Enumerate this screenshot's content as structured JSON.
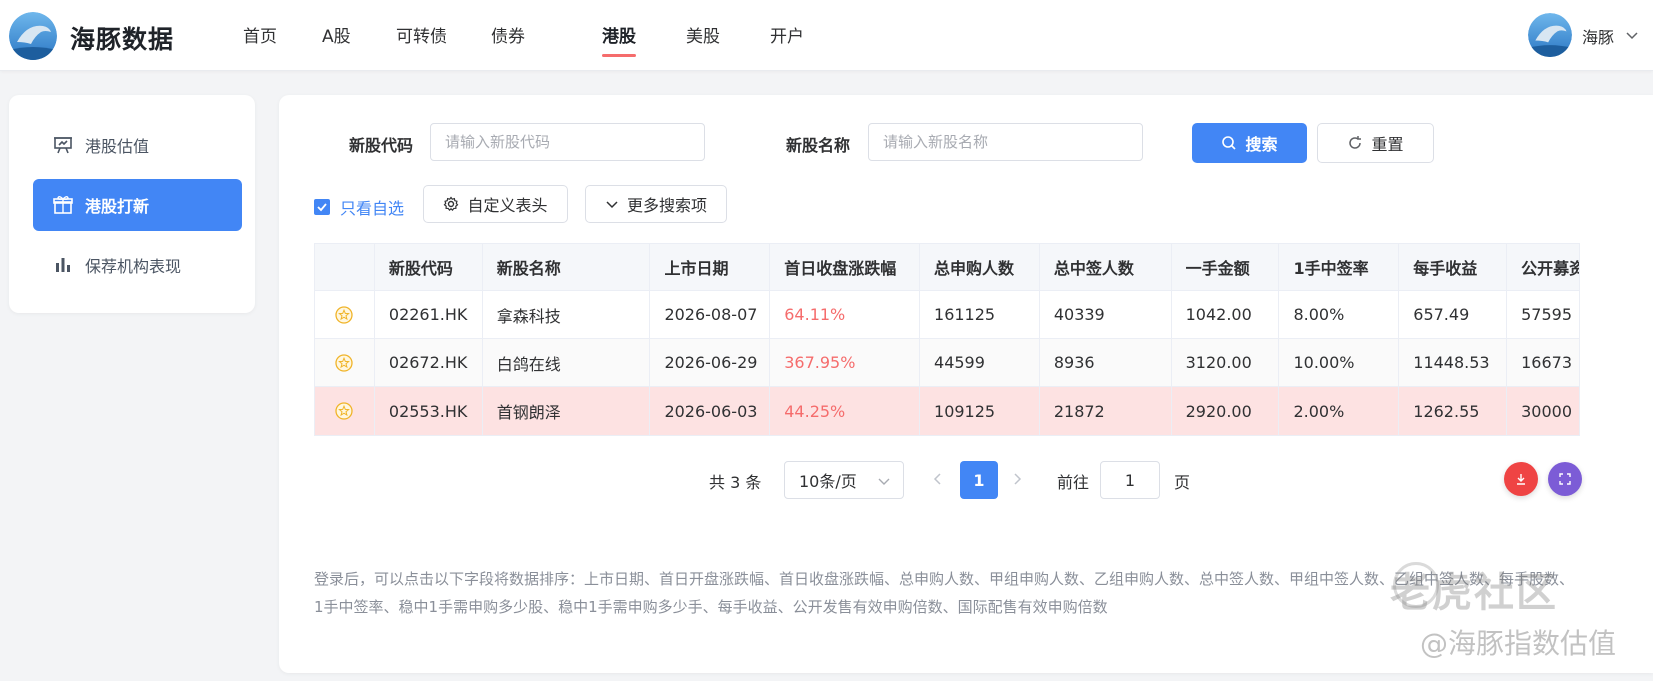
{
  "app": {
    "title": "海豚数据",
    "user_name": "海豚"
  },
  "nav": {
    "items": [
      "首页",
      "A股",
      "可转债",
      "债券",
      "港股",
      "美股",
      "开户"
    ],
    "active": "港股"
  },
  "sidebar": {
    "items": [
      {
        "label": "港股估值",
        "icon": "presentation-icon"
      },
      {
        "label": "港股打新",
        "icon": "gift-icon",
        "active": true
      },
      {
        "label": "保荐机构表现",
        "icon": "bar-chart-icon"
      }
    ]
  },
  "search": {
    "code_label": "新股代码",
    "code_placeholder": "请输入新股代码",
    "name_label": "新股名称",
    "name_placeholder": "请输入新股名称",
    "search_button": "搜索",
    "reset_button": "重置",
    "watchlist_only": "只看自选",
    "custom_header_button": "自定义表头",
    "more_filters_button": "更多搜索项"
  },
  "table": {
    "columns": [
      "",
      "新股代码",
      "新股名称",
      "上市日期",
      "首日收盘涨跌幅",
      "总申购人数",
      "总中签人数",
      "一手金额",
      "1手中签率",
      "每手收益",
      "公开募资"
    ],
    "rows": [
      [
        "",
        "02261.HK",
        "拿森科技",
        "2026-08-07",
        "64.11%",
        "161125",
        "40339",
        "1042.00",
        "8.00%",
        "657.49",
        "57595"
      ],
      [
        "",
        "02672.HK",
        "白鸽在线",
        "2026-06-29",
        "367.95%",
        "44599",
        "8936",
        "3120.00",
        "10.00%",
        "11448.53",
        "16673"
      ],
      [
        "",
        "02553.HK",
        "首钢朗泽",
        "2026-06-03",
        "44.25%",
        "109125",
        "21872",
        "2920.00",
        "2.00%",
        "1262.55",
        "30000"
      ]
    ]
  },
  "pagination": {
    "total": "共 3 条",
    "page_size": "10条/页",
    "current_page": "1",
    "goto_label": "前往",
    "goto_value": "1",
    "page_suffix": "页"
  },
  "note": "登录后，可以点击以下字段将数据排序：上市日期、首日开盘涨跌幅、首日收盘涨跌幅、总申购人数、甲组申购人数、乙组申购人数、总中签人数、甲组中签人数、乙组中签人数、每手股数、1手中签率、稳中1手需申购多少股、稳中1手需申购多少手、每手收益、公开发售有效申购倍数、国际配售有效申购倍数",
  "watermark": {
    "line1": "老虎社区",
    "line2": "@海豚指数估值"
  },
  "colors": {
    "primary": "#4286f5",
    "rise": "#f56c6c",
    "highlight_row": "#fde2e2",
    "download_button": "#ef4444",
    "fullscreen_button": "#7c5cd6"
  }
}
